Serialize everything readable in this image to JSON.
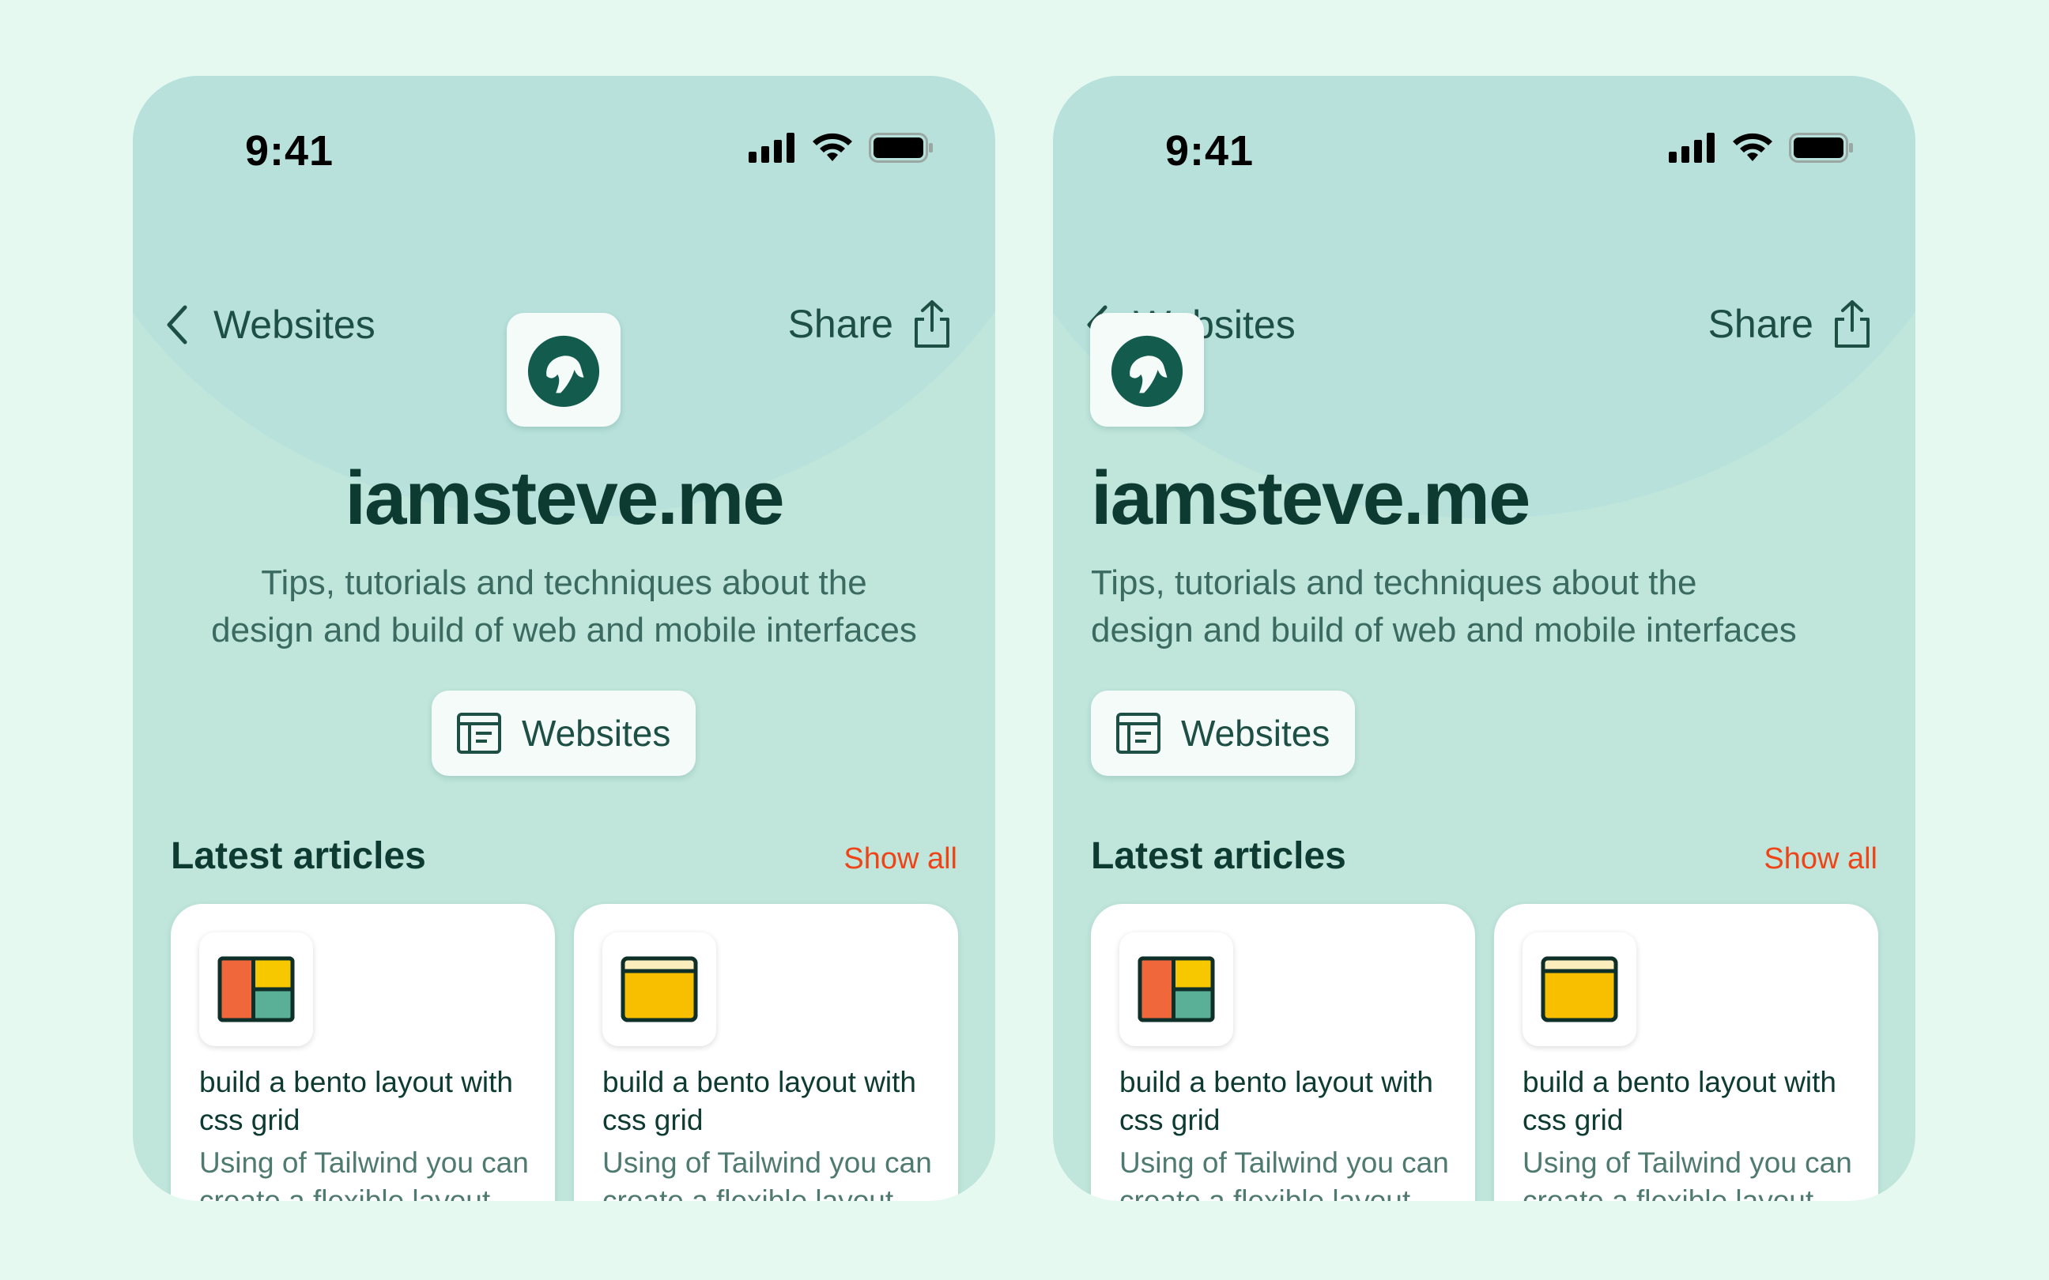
{
  "colors": {
    "background": "#e5f9f1",
    "phone": "#c0e6dc",
    "accent": "#ee4418",
    "primary_text": "#0d3a31",
    "nav_text": "#1d4f45"
  },
  "phones": [
    {
      "status": {
        "time": "9:41",
        "icons": [
          "signal-icon",
          "wifi-icon",
          "battery-icon"
        ]
      },
      "nav": {
        "back_label": "Websites",
        "share_label": "Share"
      },
      "site": {
        "title": "iamsteve.me",
        "description_line1": "Tips, tutorials and techniques about the",
        "description_line2": "design and build of web and mobile interfaces",
        "category_label": "Websites"
      },
      "articles": {
        "heading": "Latest articles",
        "show_all": "Show all",
        "items": [
          {
            "icon": "bento-layout-icon",
            "title": "build a bento layout with css grid",
            "description": "Using of Tailwind you can create a flexible layout"
          },
          {
            "icon": "browser-window-icon",
            "title": "build a bento layout with css grid",
            "description": "Using of Tailwind you can create a flexible layout"
          }
        ]
      }
    },
    {
      "status": {
        "time": "9:41",
        "icons": [
          "signal-icon",
          "wifi-icon",
          "battery-icon"
        ]
      },
      "nav": {
        "back_label": "Websites",
        "share_label": "Share"
      },
      "site": {
        "title": "iamsteve.me",
        "description_line1": "Tips, tutorials and techniques about the",
        "description_line2": "design and build of web and mobile interfaces",
        "category_label": "Websites"
      },
      "articles": {
        "heading": "Latest articles",
        "show_all": "Show all",
        "items": [
          {
            "icon": "bento-layout-icon",
            "title": "build a bento layout with css grid",
            "description": "Using of Tailwind you can create a flexible layout"
          },
          {
            "icon": "browser-window-icon",
            "title": "build a bento layout with css grid",
            "description": "Using of Tailwind you can create a flexible layout"
          }
        ]
      }
    }
  ]
}
